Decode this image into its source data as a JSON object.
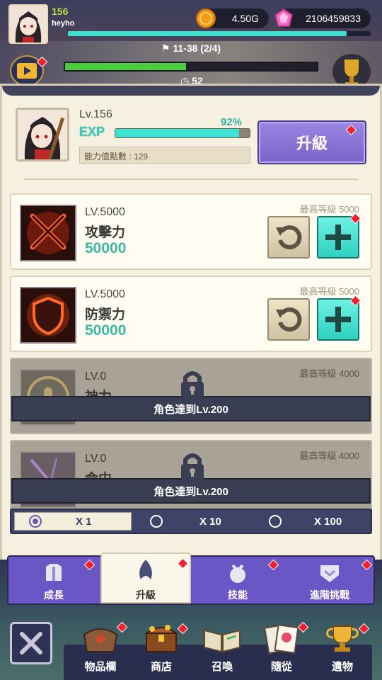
{
  "player": {
    "level": "156",
    "name": "heyho"
  },
  "currency": {
    "gold": "4.50G",
    "gems": "2106459833"
  },
  "stage": {
    "label": "11-38  (2/4)",
    "timer": "52",
    "progress": 0.48
  },
  "character": {
    "level_label": "Lv.156",
    "exp_label": "EXP",
    "exp_percent": "92%",
    "exp_fraction": 0.92,
    "ability_points": "能力值點數 : 129",
    "upgrade_label": "升級"
  },
  "stats": [
    {
      "level": "LV.5000",
      "name": "攻擊力",
      "value": "50000",
      "max": "最高等級 5000",
      "locked": false
    },
    {
      "level": "LV.5000",
      "name": "防禦力",
      "value": "50000",
      "max": "最高等級 5000",
      "locked": false
    },
    {
      "level": "LV.0",
      "name": "神力",
      "value": "",
      "max": "最高等級 4000",
      "locked": true,
      "lock_text": "角色達到Lv.200"
    },
    {
      "level": "LV.0",
      "name": "命中",
      "value": "",
      "max": "最高等級 4000",
      "locked": true,
      "lock_text": "角色達到Lv.200"
    }
  ],
  "multipliers": [
    {
      "label": "X 1",
      "selected": true
    },
    {
      "label": "X 10",
      "selected": false
    },
    {
      "label": "X 100",
      "selected": false
    }
  ],
  "tabs": [
    {
      "label": "成長",
      "icon": "armor-icon"
    },
    {
      "label": "升級",
      "icon": "flame-up-icon"
    },
    {
      "label": "技能",
      "icon": "skill-icon"
    },
    {
      "label": "進階挑戰",
      "icon": "shield-chevron-icon"
    }
  ],
  "nav": [
    {
      "label": "物品欄",
      "icon": "bag-icon"
    },
    {
      "label": "商店",
      "icon": "chest-icon"
    },
    {
      "label": "召喚",
      "icon": "book-icon"
    },
    {
      "label": "隨從",
      "icon": "pet-card-icon"
    },
    {
      "label": "遺物",
      "icon": "trophy-icon"
    }
  ],
  "colors": {
    "accent_teal": "#3fe3d3",
    "upgrade_purple": "#7864c8",
    "red_dot": "#f02030"
  }
}
